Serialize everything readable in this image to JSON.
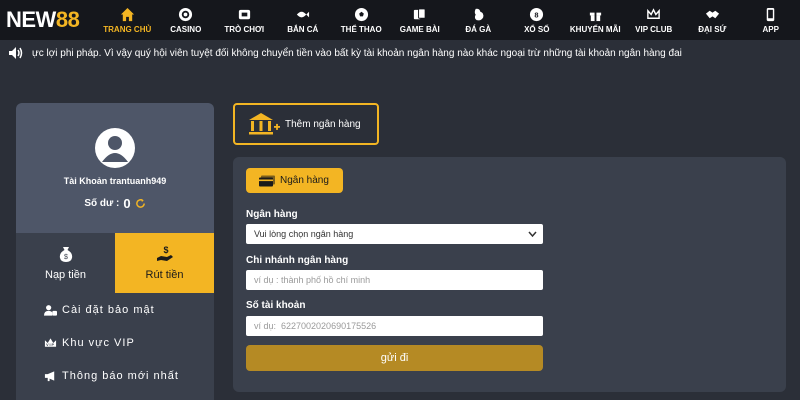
{
  "logo": {
    "text_a": "NEW",
    "text_b": "88"
  },
  "nav": [
    {
      "label": "TRANG CHỦ",
      "icon": "home-icon",
      "active": true
    },
    {
      "label": "CASINO",
      "icon": "casino-chip-icon"
    },
    {
      "label": "TRÒ CHƠI",
      "icon": "game-icon"
    },
    {
      "label": "BẮN CÁ",
      "icon": "fish-icon"
    },
    {
      "label": "THỂ THAO",
      "icon": "soccer-ball-icon"
    },
    {
      "label": "GAME BÀI",
      "icon": "cards-icon"
    },
    {
      "label": "ĐÁ GÀ",
      "icon": "rooster-icon"
    },
    {
      "label": "XỔ SỐ",
      "icon": "lottery-icon"
    },
    {
      "label": "KHUYẾN MÃI",
      "icon": "gift-icon"
    },
    {
      "label": "VIP CLUB",
      "icon": "crown-icon"
    },
    {
      "label": "ĐẠI SỨ",
      "icon": "handshake-icon"
    },
    {
      "label": "APP",
      "icon": "app-icon"
    }
  ],
  "marquee": {
    "text": "ực lợi phi pháp. Vì vậy quý hội viên tuyệt đối không chuyển tiền vào bất kỳ tài khoản ngân hàng nào khác ngoại trừ những tài khoản ngân hàng đai"
  },
  "profile": {
    "username": "Tài Khoản trantuanh949",
    "balance_label": "Số dư :",
    "balance_value": "0"
  },
  "tabs": {
    "deposit": "Nạp tiền",
    "withdraw": "Rút tiền"
  },
  "menu": [
    {
      "label": "Cài đặt bảo mật",
      "icon": "user-lock-icon"
    },
    {
      "label": "Khu vực VIP",
      "icon": "vip-crown-icon"
    },
    {
      "label": "Thông báo mới nhất",
      "icon": "megaphone-icon"
    }
  ],
  "add_bank": {
    "label": "Thêm ngân hàng"
  },
  "form": {
    "tag": "Ngân hàng",
    "bank_label": "Ngân hàng",
    "bank_select_value": "Vui lòng chọn ngân hàng",
    "branch_label": "Chi nhánh ngân hàng",
    "branch_placeholder": "ví dụ : thành phố hồ chí minh",
    "account_label": "Số tài khoản",
    "account_placeholder": "ví dụ:  6227002020690175526",
    "submit": "gửi đi"
  },
  "colors": {
    "accent": "#f3b523",
    "nav_bg": "#15171c",
    "page_bg": "#2b2f38",
    "panel_bg": "#3a404c",
    "profile_bg": "#4e5668",
    "submit_bg": "#b58a24"
  }
}
